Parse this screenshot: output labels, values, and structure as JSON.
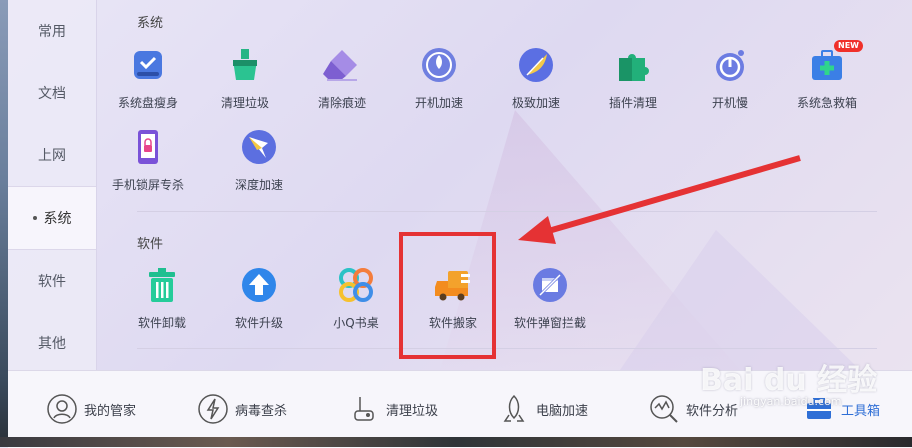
{
  "sidebar": {
    "items": [
      {
        "label": "常用"
      },
      {
        "label": "文档"
      },
      {
        "label": "上网"
      },
      {
        "label": "系统"
      },
      {
        "label": "软件"
      },
      {
        "label": "其他"
      }
    ],
    "active_index": 3
  },
  "sections": {
    "system": {
      "title": "系统",
      "tiles": [
        {
          "label": "系统盘瘦身",
          "icon": "disk-slim-icon"
        },
        {
          "label": "清理垃圾",
          "icon": "broom-icon"
        },
        {
          "label": "清除痕迹",
          "icon": "eraser-icon"
        },
        {
          "label": "开机加速",
          "icon": "rocket-icon"
        },
        {
          "label": "极致加速",
          "icon": "feather-icon"
        },
        {
          "label": "插件清理",
          "icon": "puzzle-icon"
        },
        {
          "label": "开机慢",
          "icon": "power-icon"
        },
        {
          "label": "系统急救箱",
          "icon": "first-aid-icon",
          "badge": "NEW"
        },
        {
          "label": "手机锁屏专杀",
          "icon": "phone-lock-icon"
        },
        {
          "label": "深度加速",
          "icon": "compass-icon"
        }
      ]
    },
    "software": {
      "title": "软件",
      "tiles": [
        {
          "label": "软件卸载",
          "icon": "trash-icon"
        },
        {
          "label": "软件升级",
          "icon": "upgrade-arrow-icon"
        },
        {
          "label": "小Q书桌",
          "icon": "clover-icon"
        },
        {
          "label": "软件搬家",
          "icon": "moving-truck-icon"
        },
        {
          "label": "软件弹窗拦截",
          "icon": "block-popup-icon"
        }
      ]
    }
  },
  "bottom_bar": {
    "items": [
      {
        "label": "我的管家",
        "icon": "avatar-icon"
      },
      {
        "label": "病毒查杀",
        "icon": "virus-shield-icon"
      },
      {
        "label": "清理垃圾",
        "icon": "vacuum-icon"
      },
      {
        "label": "电脑加速",
        "icon": "rocket-icon"
      },
      {
        "label": "软件分析",
        "icon": "analysis-icon"
      },
      {
        "label": "工具箱",
        "icon": "toolbox-icon"
      }
    ],
    "active_index": 5
  },
  "watermark": {
    "brand": "Bai du 经验",
    "sub": "jingyan.baidu.com"
  },
  "colors": {
    "accent": "#2f6fd6",
    "annotation": "#e53234",
    "new_badge": "#f0302a"
  }
}
